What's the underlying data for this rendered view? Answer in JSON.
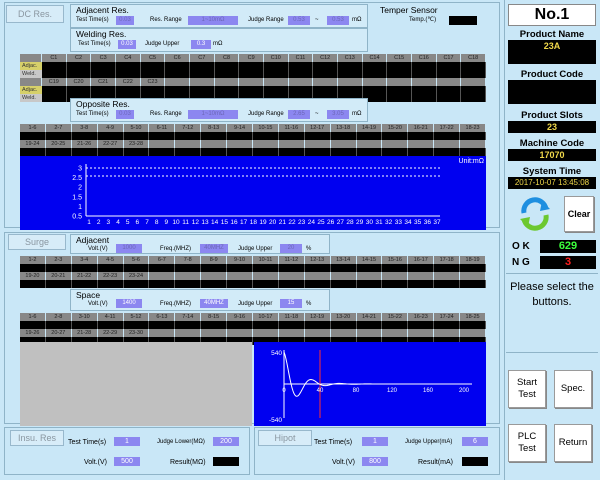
{
  "dc_tab": "DC Res.",
  "adjacent_res": {
    "title": "Adjacent Res.",
    "test_time_label": "Test Time(s)",
    "test_time": "0.03",
    "res_range_label": "Res. Range",
    "res_range": "1~10mΩ",
    "judge_range_label": "Judge Range",
    "judge_low": "0.53",
    "judge_sep": "~",
    "judge_high": "0.53",
    "unit": "mΩ"
  },
  "welding_res": {
    "title": "Welding Res.",
    "test_time_label": "Test Time(s)",
    "test_time": "0.03",
    "judge_upper_label": "Judge Upper",
    "judge_upper": "0.3",
    "unit": "mΩ"
  },
  "temper": {
    "title": "Temper Sensor",
    "temp_label": "Temp.(℃)"
  },
  "adj_grid": {
    "row1_cols": [
      "C1",
      "C2",
      "C3",
      "C4",
      "C5",
      "C6",
      "C7",
      "C8",
      "C9",
      "C10",
      "C11",
      "C12",
      "C13",
      "C14",
      "C15",
      "C16",
      "C17",
      "C18"
    ],
    "row2_cols": [
      "C19",
      "C20",
      "C21",
      "C22",
      "C23"
    ],
    "row_adjac": "Adjac.",
    "row_weld": "Weld."
  },
  "opposite_res": {
    "title": "Opposite Res.",
    "test_time_label": "Test Time(s)",
    "test_time": "0.03",
    "res_range_label": "Res. Range",
    "res_range": "1~10mΩ",
    "judge_range_label": "Judge Range",
    "judge_low": "2.65",
    "judge_sep": "~",
    "judge_high": "3.05",
    "unit": "mΩ"
  },
  "opp_grid": {
    "row1": [
      "1-6",
      "2-7",
      "3-8",
      "4-9",
      "5-10",
      "6-11",
      "7-12",
      "8-13",
      "9-14",
      "10-15",
      "11-16",
      "12-17",
      "13-18",
      "14-19",
      "15-20",
      "16-21",
      "17-22",
      "18-23"
    ],
    "row2": [
      "19-24",
      "20-25",
      "21-26",
      "22-27",
      "23-28"
    ]
  },
  "dc_chart": {
    "unit": "Unit:mΩ",
    "y_ticks": [
      "3",
      "2.5",
      "2",
      "1.5",
      "1",
      "0.5"
    ],
    "x_ticks": [
      "1",
      "2",
      "3",
      "4",
      "5",
      "6",
      "7",
      "8",
      "9",
      "10",
      "11",
      "12",
      "13",
      "14",
      "15",
      "16",
      "17",
      "18",
      "19",
      "20",
      "21",
      "22",
      "23",
      "24",
      "25",
      "26",
      "27",
      "28",
      "29",
      "30",
      "31",
      "32",
      "33",
      "34",
      "35",
      "36",
      "37"
    ]
  },
  "surge_tab": "Surge",
  "surge_adjacent": {
    "title": "Adjacent",
    "volt_label": "Volt.(V)",
    "volt": "1000",
    "freq_label": "Freq.(MHZ)",
    "freq": "40MHZ",
    "judge_upper_label": "Judge Upper",
    "judge_upper": "20",
    "unit": "%"
  },
  "surge_adj_grid": {
    "row1": [
      "1-2",
      "2-3",
      "3-4",
      "4-5",
      "5-6",
      "6-7",
      "7-8",
      "8-9",
      "9-10",
      "10-11",
      "11-12",
      "12-13",
      "13-14",
      "14-15",
      "15-16",
      "16-17",
      "17-18",
      "18-19"
    ],
    "row2": [
      "19-20",
      "20-21",
      "21-22",
      "22-23",
      "23-24"
    ]
  },
  "surge_space": {
    "title": "Space",
    "volt_label": "Volt.(V)",
    "volt": "1400",
    "freq_label": "Freq.(MHZ)",
    "freq": "40MHZ",
    "judge_upper_label": "Judge Upper",
    "judge_upper": "15",
    "unit": "%"
  },
  "surge_space_grid": {
    "row1": [
      "1-6",
      "2-8",
      "3-10",
      "4-11",
      "5-12",
      "6-13",
      "7-14",
      "8-15",
      "9-16",
      "10-17",
      "11-18",
      "12-19",
      "13-20",
      "14-21",
      "15-22",
      "16-23",
      "17-24",
      "18-25"
    ],
    "row2": [
      "19-26",
      "20-27",
      "21-28",
      "22-29",
      "23-30"
    ]
  },
  "wave_chart": {
    "y_top": "540",
    "y_bottom": "-540",
    "x_ticks": [
      "0",
      "40",
      "80",
      "120",
      "160",
      "200"
    ]
  },
  "insu": {
    "tab": "Insu. Res",
    "test_time_label": "Test Time(s)",
    "test_time": "1",
    "judge_lower_label": "Judge Lower(MΩ)",
    "judge_lower": "200",
    "volt_label": "Volt.(V)",
    "volt": "500",
    "result_label": "Result(MΩ)"
  },
  "hipot": {
    "tab": "Hipot",
    "test_time_label": "Test Time(s)",
    "test_time": "1",
    "judge_upper_label": "Judge Upper(mA)",
    "judge_upper": "6",
    "volt_label": "Volt.(V)",
    "volt": "800",
    "result_label": "Result(mA)"
  },
  "right": {
    "station": "No.1",
    "product_name_label": "Product Name",
    "product_name": "23A",
    "product_code_label": "Product Code",
    "product_slots_label": "Product Slots",
    "product_slots": "23",
    "machine_code_label": "Machine Code",
    "machine_code": "17070",
    "system_time_label": "System Time",
    "system_time": "2017-10-07 13:45:08",
    "clear": "Clear",
    "ok_label": "O K",
    "ok_count": "629",
    "ng_label": "N G",
    "ng_count": "3",
    "message": "Please select the buttons.",
    "start_test": "Start Test",
    "spec": "Spec.",
    "plc_test": "PLC Test",
    "return": "Return"
  },
  "colors": {
    "chart_bg": "#0000f0",
    "ok": "#3cff3c",
    "ng": "#ff2020",
    "accent": "#f0d84a"
  }
}
